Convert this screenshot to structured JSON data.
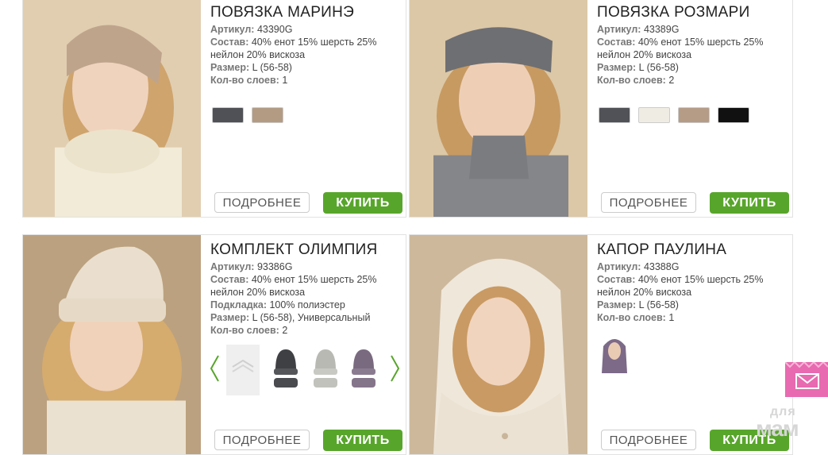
{
  "products": [
    {
      "title": "ПОВЯЗКА МАРИНЭ",
      "article_label": "Артикул:",
      "article": "43390G",
      "composition_label": "Состав:",
      "composition_line1": "40% енот 15% шерсть 25%",
      "composition_line2": "нейлон 20% вискоза",
      "size_label": "Размер:",
      "size": "L (56-58)",
      "layers_label": "Кол-во слоев:",
      "layers": "1",
      "swatches": [
        "#4f5156",
        "#b39b83"
      ],
      "more_label": "ПОДРОБНЕЕ",
      "buy_label": "КУПИТЬ"
    },
    {
      "title": "ПОВЯЗКА РОЗМАРИ",
      "article_label": "Артикул:",
      "article": "43389G",
      "composition_label": "Состав:",
      "composition_line1": "40% енот 15% шерсть 25%",
      "composition_line2": "нейлон 20% вискоза",
      "size_label": "Размер:",
      "size": "L (56-58)",
      "layers_label": "Кол-во слоев:",
      "layers": "2",
      "swatches": [
        "#505257",
        "#efece4",
        "#b59c87",
        "#111111"
      ],
      "more_label": "ПОДРОБНЕЕ",
      "buy_label": "КУПИТЬ"
    },
    {
      "title": "КОМПЛЕКТ ОЛИМПИЯ",
      "article_label": "Артикул:",
      "article": "93386G",
      "composition_label": "Состав:",
      "composition_line1": "40% енот 15% шерсть 25%",
      "composition_line2": "нейлон 20% вискоза",
      "lining_label": "Подкладка:",
      "lining": "100% полиэстер",
      "size_label": "Размер:",
      "size": "L (56-58), Универсальный",
      "layers_label": "Кол-во слоев:",
      "layers": "2",
      "more_label": "ПОДРОБНЕЕ",
      "buy_label": "КУПИТЬ"
    },
    {
      "title": "КАПОР ПАУЛИНА",
      "article_label": "Артикул:",
      "article": "43388G",
      "composition_label": "Состав:",
      "composition_line1": "40% енот 15% шерсть 25%",
      "composition_line2": "нейлон 20% вискоза",
      "size_label": "Размер:",
      "size": "L (56-58)",
      "layers_label": "Кол-во слоев:",
      "layers": "1",
      "more_label": "ПОДРОБНЕЕ",
      "buy_label": "КУПИТЬ"
    }
  ],
  "colors": {
    "buy": "#58a52b",
    "arrow": "#58a52b",
    "mail": "#e86ab0"
  },
  "watermark": {
    "line1": "для",
    "line2": "мам"
  }
}
